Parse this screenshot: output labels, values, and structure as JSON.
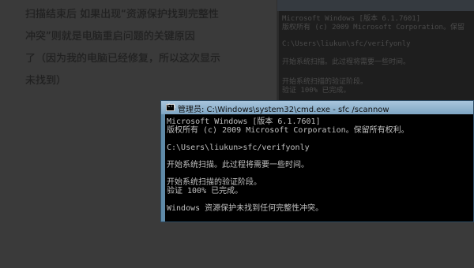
{
  "article": {
    "lines": [
      "扫描结束后 如果出现“资源保护找到完整性",
      "冲突”则就是电脑重启问题的关键原因",
      "了（因为我的电脑已经修复，所以这次显示",
      "未找到）"
    ]
  },
  "bg_console": {
    "lines": [
      "Microsoft Windows [版本 6.1.7601]",
      "版权所有 (c) 2009 Microsoft Corporation。保留",
      "C:\\Users\\liukun\\sfc/verifyonly",
      "开始系统扫描。此过程将需要一些时间。",
      "开始系统扫描的验证阶段。",
      "验证 100% 已完成。"
    ]
  },
  "cmd": {
    "title": "管理员: C:\\Windows\\system32\\cmd.exe - sfc /scannow",
    "icon_text": "C:\\",
    "lines": [
      "Microsoft Windows [版本 6.1.7601]",
      "版权所有 (c) 2009 Microsoft Corporation。保留所有权利。",
      "",
      "C:\\Users\\liukun>sfc/verifyonly",
      "",
      "开始系统扫描。此过程将需要一些时间。",
      "",
      "开始系统扫描的验证阶段。",
      "验证 100% 已完成。",
      "",
      "Windows 资源保护未找到任何完整性冲突。"
    ]
  },
  "colors": {
    "background": "#3a3a3a",
    "console_bg": "#000000",
    "console_text": "#c0c0c0",
    "titlebar": "#8fb3cf"
  }
}
